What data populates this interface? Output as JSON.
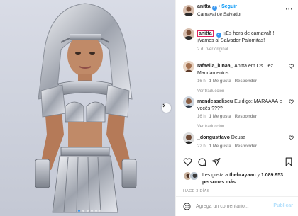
{
  "post": {
    "author": "anitta",
    "follow_label": "Seguir",
    "separator": "•",
    "location": "Carnaval de Salvador",
    "more_glyph": "···",
    "verified_glyph": "✓",
    "caption": {
      "user": "anitta",
      "text": "¡¡Es hora de carnaval!!! ¡Vamos al Salvador Palomitas!",
      "time": "2 d",
      "translate_label": "Ver original"
    },
    "comments": [
      {
        "user": "rafaella_lunaa_",
        "text": "Anitta em Os Dez Mandamentos",
        "time": "16 h",
        "likes": "1 Me gusta",
        "reply_label": "Responder",
        "translate_label": "Ver traducción"
      },
      {
        "user": "mendesseliseu",
        "text": "Eu digo: MARAAAA e vocês ????",
        "time": "16 h",
        "likes": "1 Me gusta",
        "reply_label": "Responder",
        "translate_label": "Ver traducción"
      },
      {
        "user": "_dongusttavo",
        "text": "Deusa",
        "time": "22 h",
        "likes": "1 Me gusta",
        "reply_label": "Responder",
        "translate_label": ""
      }
    ],
    "likes": {
      "prefix": "Les gusta a",
      "liker": "thebrayaan",
      "connector": "y",
      "count": "1.089.953 personas más"
    },
    "date": "HACE 3 DÍAS",
    "comment_placeholder": "Agrega un comentario...",
    "publish_label": "Publicar",
    "carousel": {
      "total_slides": 6,
      "active_index": 0
    }
  },
  "colors": {
    "accent": "#0095f6",
    "verified": "#3897f0",
    "muted": "#8e8e8e",
    "highlight_border": "#e0245e",
    "publish_disabled": "#b2dffc"
  },
  "icons": {
    "header": "more-options-icon",
    "actions": [
      "heart-icon",
      "comment-icon",
      "share-icon",
      "bookmark-icon"
    ],
    "photo": "chevron-right-icon",
    "composer": "emoji-icon"
  }
}
